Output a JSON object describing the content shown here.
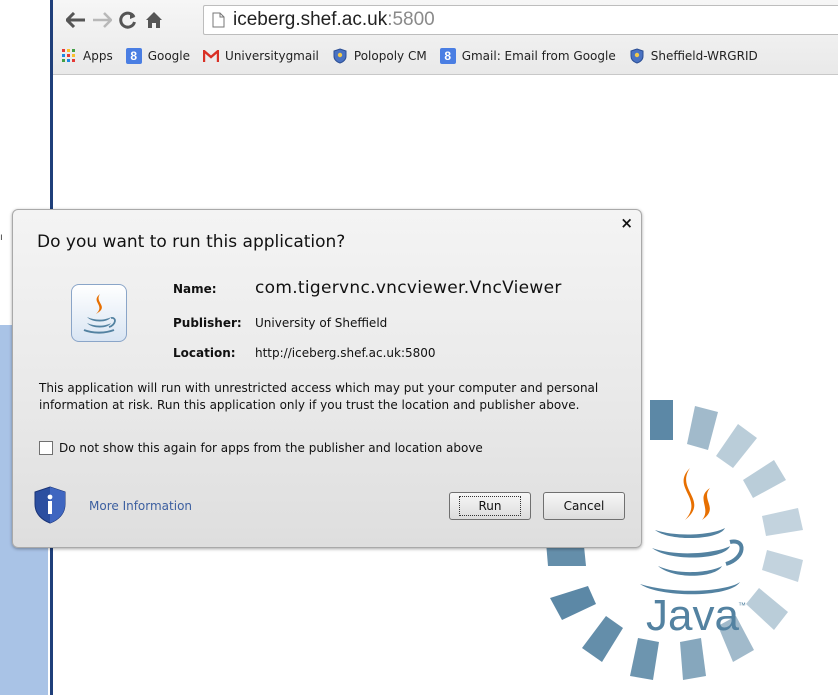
{
  "browser": {
    "url_host": "iceberg.shef.ac.uk",
    "url_port": ":5800",
    "bookmarks": [
      {
        "label": "Apps",
        "icon": "apps-grid-icon"
      },
      {
        "label": "Google",
        "icon": "google-icon"
      },
      {
        "label": "Universitygmail",
        "icon": "gmail-icon"
      },
      {
        "label": "Polopoly CM",
        "icon": "shield-favicon-icon"
      },
      {
        "label": "Gmail: Email from Google",
        "icon": "google-icon"
      },
      {
        "label": "Sheffield-WRGRID",
        "icon": "shield-favicon-icon"
      }
    ]
  },
  "dialog": {
    "title": "Do you want to run this application?",
    "name_label": "Name:",
    "name_value": "com.tigervnc.vncviewer.VncViewer",
    "publisher_label": "Publisher:",
    "publisher_value": "University of Sheffield",
    "location_label": "Location:",
    "location_value": "http://iceberg.shef.ac.uk:5800",
    "warning_text": "This application will run with unrestricted access which may put your computer and personal information at risk. Run this application only if you trust the location and publisher above.",
    "checkbox_label": "Do not show this again for apps from the publisher and location above",
    "checkbox_checked": false,
    "more_info": "More Information",
    "run_label": "Run",
    "cancel_label": "Cancel",
    "close_symbol": "×"
  },
  "background": {
    "java_brand": "Java",
    "stray_text": "ı"
  },
  "colors": {
    "java_blue": "#5382a1",
    "java_orange": "#e76f00",
    "window_border": "#1f3f7a",
    "link": "#3c5fa0"
  }
}
